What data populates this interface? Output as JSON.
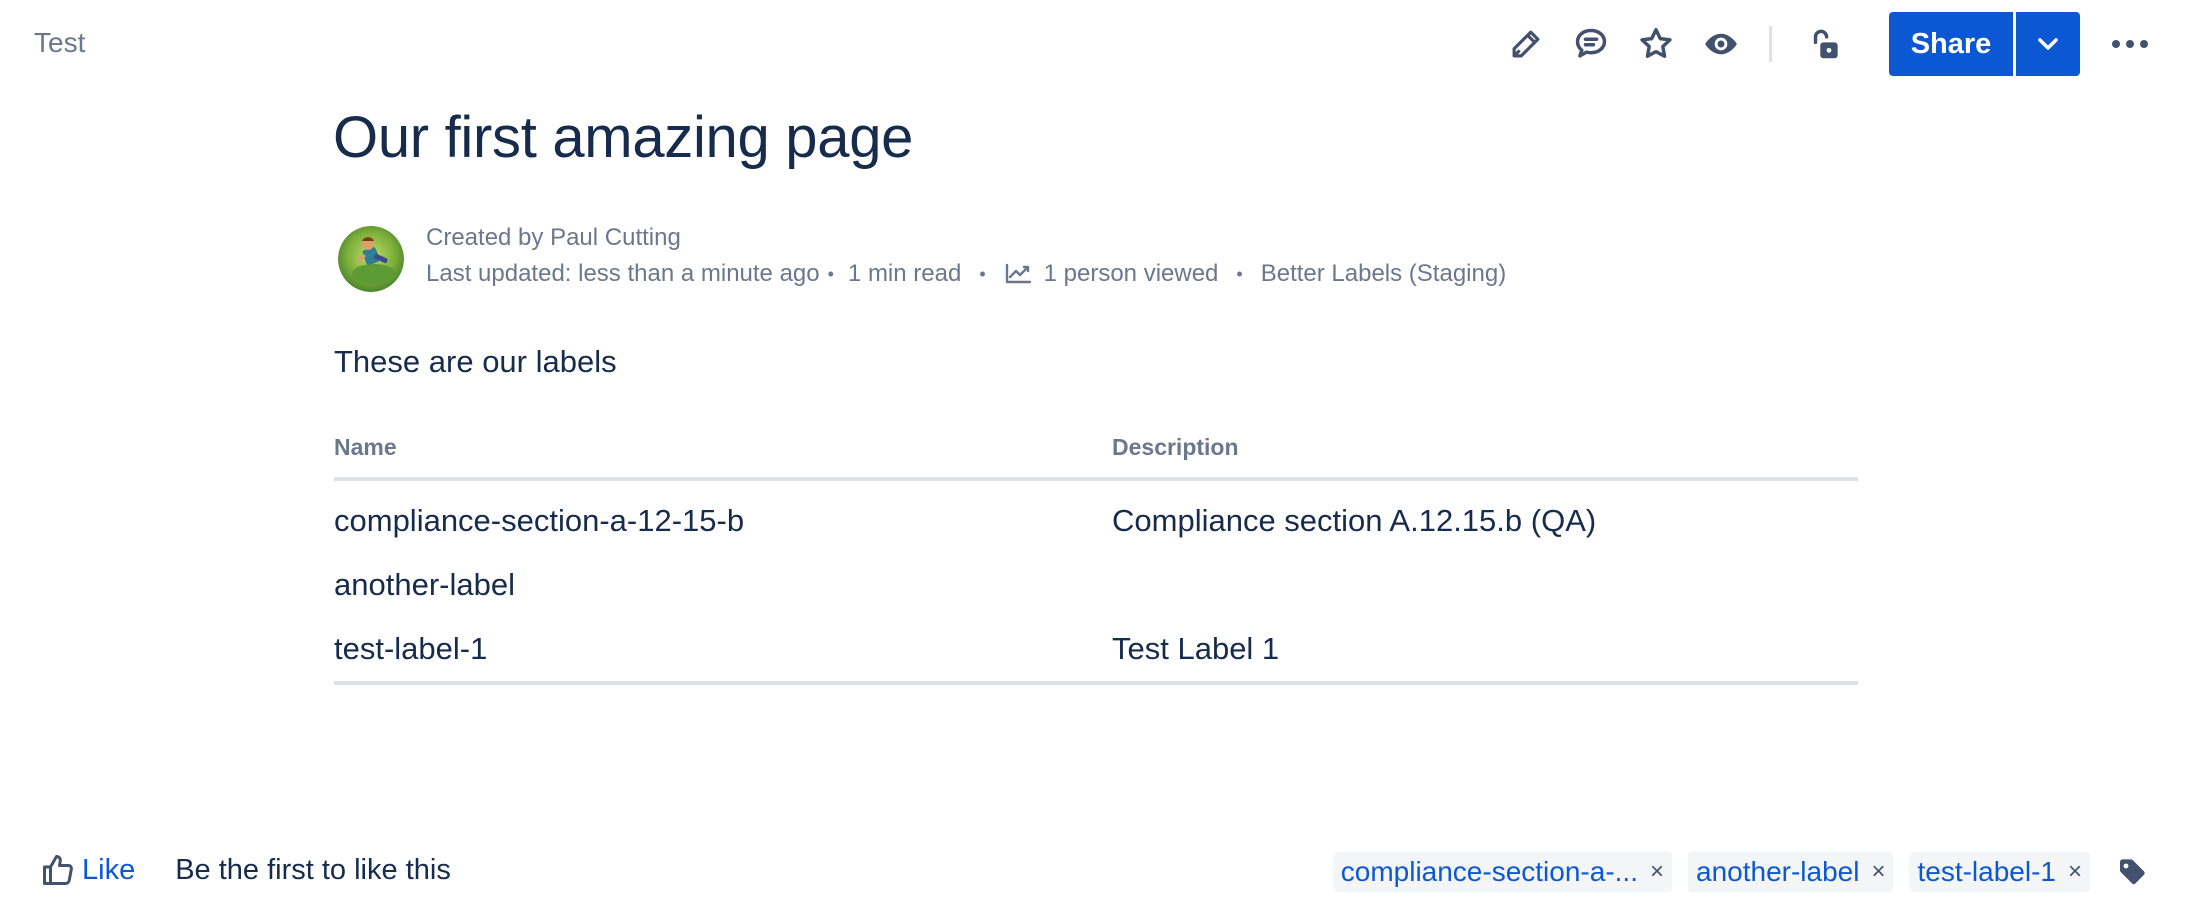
{
  "breadcrumb": {
    "space_name": "Test"
  },
  "toolbar": {
    "icons": [
      "edit-icon",
      "comment-icon",
      "star-icon",
      "watch-icon",
      "unlock-icon"
    ],
    "share_label": "Share",
    "dropdown_icon": "chevron-down-icon",
    "more_icon": "more-icon"
  },
  "page": {
    "title": "Our first amazing page",
    "byline": {
      "created_by": "Created by Paul Cutting",
      "last_updated": "Last updated: less than a minute ago",
      "read_time": "1 min read",
      "views": "1 person viewed",
      "app": "Better Labels (Staging)"
    },
    "intro": "These are our labels"
  },
  "table": {
    "headers": {
      "name": "Name",
      "description": "Description"
    },
    "rows": [
      {
        "name": "compliance-section-a-12-15-b",
        "description": "Compliance section A.12.15.b (QA)"
      },
      {
        "name": "another-label",
        "description": ""
      },
      {
        "name": "test-label-1",
        "description": "Test Label 1"
      }
    ]
  },
  "footer": {
    "like_label": "Like",
    "like_status": "Be the first to like this",
    "labels": [
      {
        "text": "compliance-section-a-...",
        "remove": "×"
      },
      {
        "text": "another-label",
        "remove": "×"
      },
      {
        "text": "test-label-1",
        "remove": "×"
      }
    ],
    "tag_icon": "tag-icon"
  },
  "colors": {
    "primary": "#0c58d3",
    "text": "#172b4d",
    "subtle_text": "#6b778c",
    "icon": "#42526e",
    "border": "#dfe1e6"
  }
}
